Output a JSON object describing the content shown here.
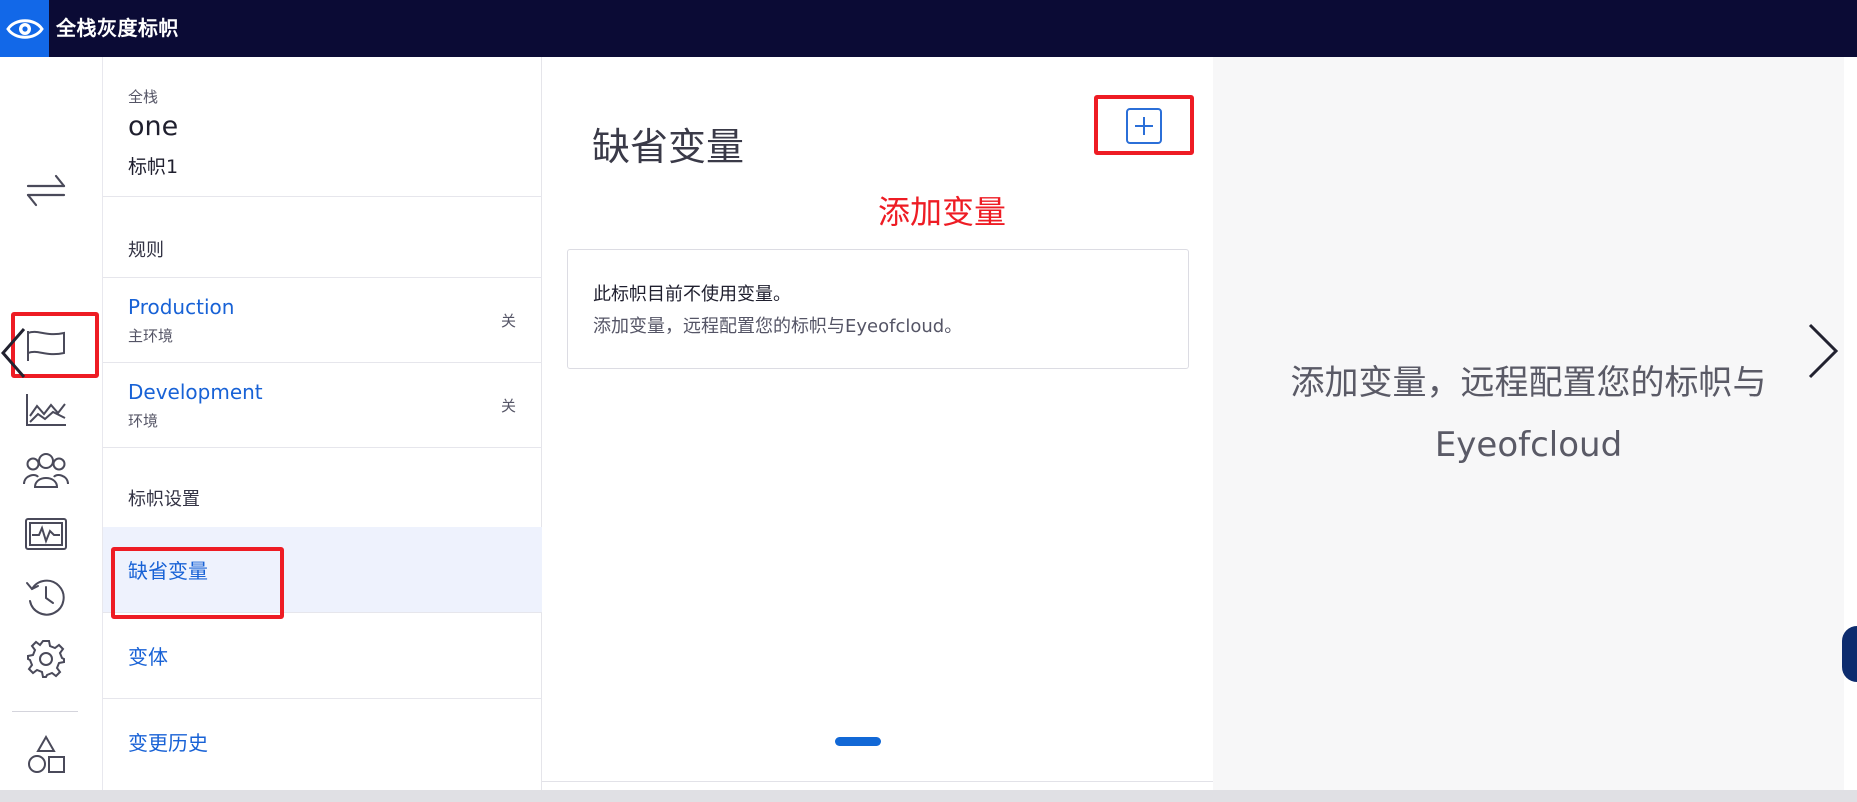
{
  "app": {
    "title": "全栈灰度标帜"
  },
  "rail": {
    "icons": [
      "swap-icon",
      "flag-icon",
      "chart-line-icon",
      "users-icon",
      "monitor-pulse-icon",
      "history-icon",
      "settings-gear-icon",
      "shapes-icon"
    ]
  },
  "flag": {
    "crumb": "全栈",
    "key": "one",
    "name": "标帜1"
  },
  "sections": {
    "rules": "规则",
    "flag_settings": "标帜设置"
  },
  "environments": [
    {
      "name": "Production",
      "type": "主环境",
      "state": "关"
    },
    {
      "name": "Development",
      "type": "环境",
      "state": "关"
    }
  ],
  "nav": {
    "default_variables": "缺省变量",
    "variations": "变体",
    "change_history": "变更历史"
  },
  "main": {
    "title": "缺省变量",
    "add_button_icon": "plus-icon",
    "annotation": "添加变量",
    "empty_title": "此标帜目前不使用变量。",
    "empty_desc": "添加变量，远程配置您的标帜与Eyeofcloud。"
  },
  "right_panel": {
    "line1": "添加变量，远程配置您的标帜与",
    "line2": "Eyeofcloud"
  },
  "colors": {
    "topbar": "#0b0b35",
    "brand": "#1268e8",
    "link": "#1862d6",
    "annotation": "#ee1c24",
    "selected_bg": "#eef2fd"
  }
}
